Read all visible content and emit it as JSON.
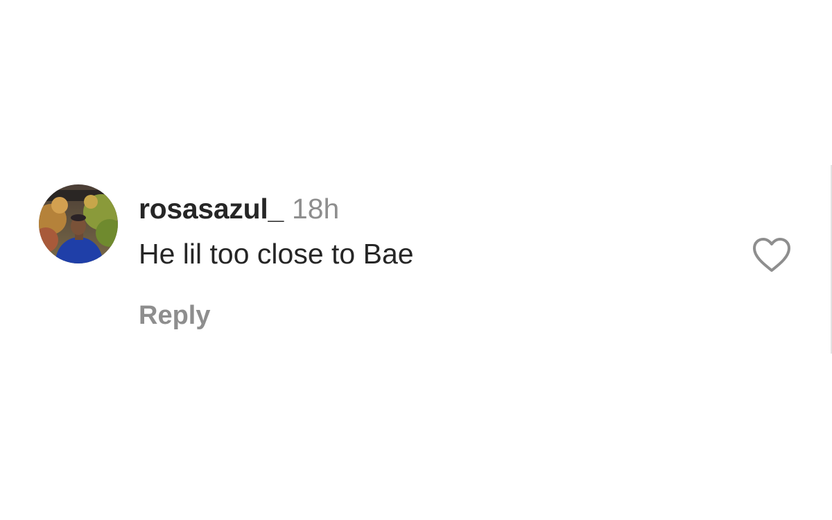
{
  "comment": {
    "username": "rosasazul_",
    "time": "18h",
    "text": "He lil too close to Bae",
    "reply_label": "Reply",
    "avatar_icon": "user-avatar-photo",
    "like_icon": "heart-outline-icon"
  },
  "colors": {
    "text_primary": "#262626",
    "text_secondary": "#8e8e8e",
    "background": "#ffffff"
  }
}
